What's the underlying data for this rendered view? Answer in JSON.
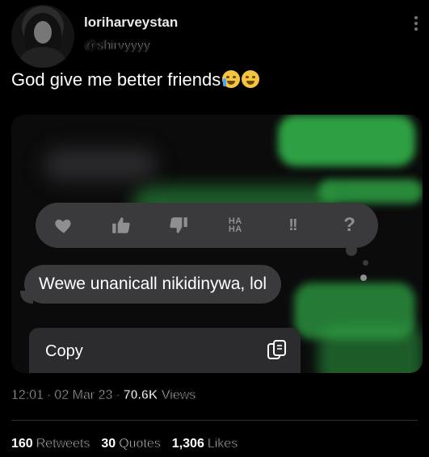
{
  "user": {
    "display_name": "loriharveystan",
    "handle": "@shirvyyyy"
  },
  "tweet": {
    "text": "God give me better friends",
    "emojis": [
      "crying-face",
      "grinning-sweat-face"
    ]
  },
  "media": {
    "reactions": [
      "heart-icon",
      "thumbs-up-icon",
      "thumbs-down-icon",
      "haha-icon",
      "exclamation-icon",
      "question-icon"
    ],
    "haha_top": "HA",
    "haha_bottom": "HA",
    "exclaim_text": "!!",
    "question_text": "?",
    "message_text": "Wewe unanicall nikidinywa, lol",
    "context_menu_label": "Copy",
    "bubble_color": "#3a3a3c",
    "accent_green": "#2ea043"
  },
  "meta": {
    "time": "12:01",
    "date": "02 Mar 23",
    "views_count": "70.6K",
    "views_label": "Views"
  },
  "stats": {
    "retweets_count": "160",
    "retweets_label": "Retweets",
    "quotes_count": "30",
    "quotes_label": "Quotes",
    "likes_count": "1,306",
    "likes_label": "Likes"
  }
}
